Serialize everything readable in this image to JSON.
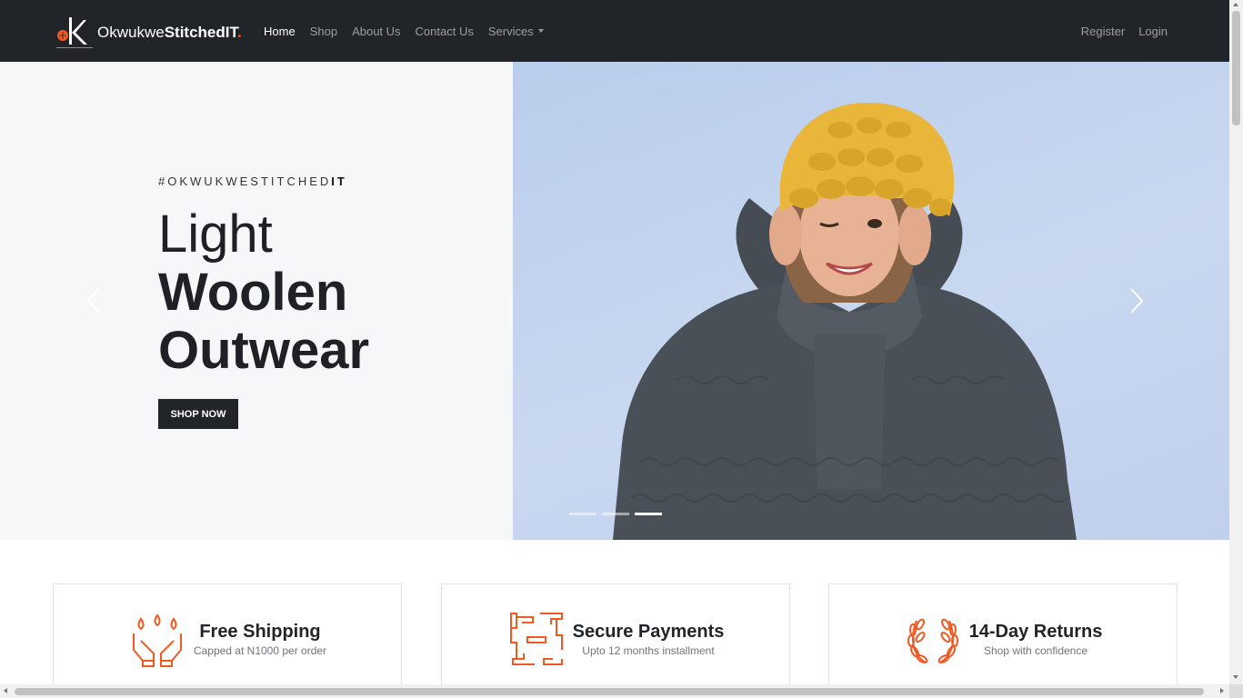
{
  "brand": {
    "name_light": "Okwukwe",
    "name_bold": "StitchedIT",
    "name_dot": "."
  },
  "nav": {
    "items": [
      {
        "label": "Home",
        "active": true
      },
      {
        "label": "Shop"
      },
      {
        "label": "About Us"
      },
      {
        "label": "Contact Us"
      },
      {
        "label": "Services",
        "dropdown": true
      }
    ],
    "register": "Register",
    "login": "Login"
  },
  "hero": {
    "tagline_main": "#OKWUKWESTITCHED",
    "tagline_bold": "IT",
    "headline": [
      "Light",
      "Woolen",
      "Outwear"
    ],
    "cta": "SHOP NOW",
    "slides_total": 3,
    "active_slide": 3,
    "prev_icon": "chevron-left-icon",
    "next_icon": "chevron-right-icon"
  },
  "features": [
    {
      "title": "Free Shipping",
      "subtitle": "Capped at N1000 per order",
      "icon": "hands-water-drops-icon"
    },
    {
      "title": "Secure Payments",
      "subtitle": "Upto 12 months installment",
      "icon": "linked-hands-icon"
    },
    {
      "title": "14-Day Returns",
      "subtitle": "Shop with confidence",
      "icon": "laurel-wreath-icon"
    }
  ],
  "colors": {
    "navbar": "#212529",
    "accent": "#f05a22",
    "hero_left_bg": "#f6f7f9",
    "hero_right_bg": "#c4d5ef"
  }
}
